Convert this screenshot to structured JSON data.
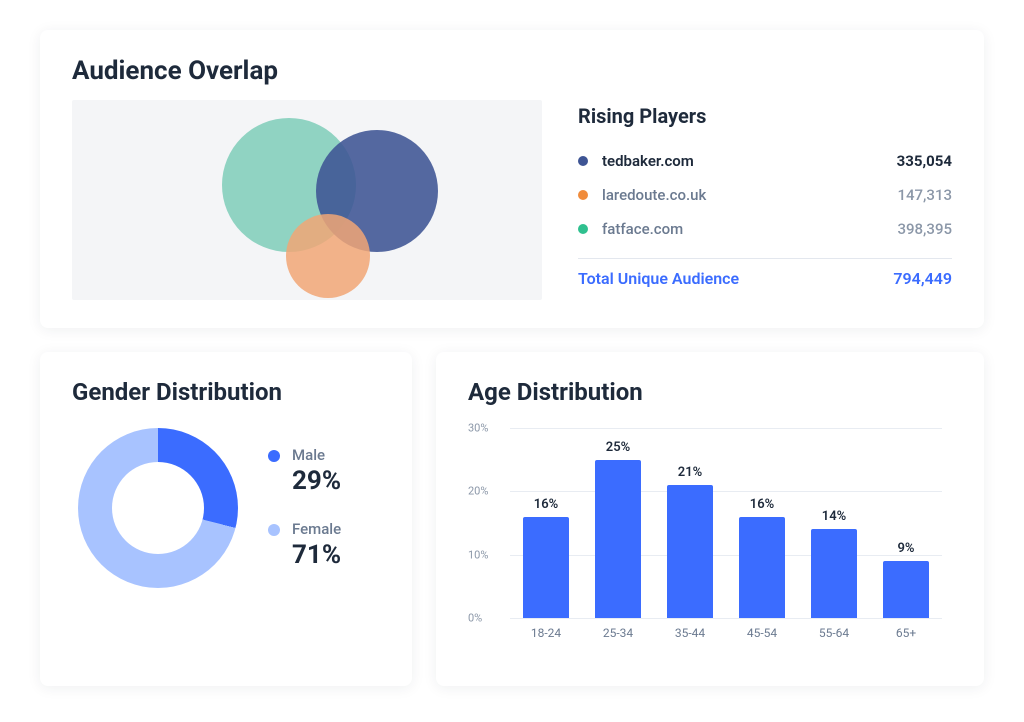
{
  "overlap": {
    "title": "Audience Overlap",
    "players_title": "Rising Players",
    "players": [
      {
        "name": "tedbaker.com",
        "value": "335,054",
        "color": "#3e5494"
      },
      {
        "name": "laredoute.co.uk",
        "value": "147,313",
        "color": "#f08c3c"
      },
      {
        "name": "fatface.com",
        "value": "398,395",
        "color": "#2fc08f"
      }
    ],
    "total_label": "Total Unique Audience",
    "total_value": "794,449"
  },
  "gender": {
    "title": "Gender Distribution",
    "items": [
      {
        "label": "Male",
        "value": "29%",
        "color": "#3b6cff"
      },
      {
        "label": "Female",
        "value": "71%",
        "color": "#a8c3ff"
      }
    ]
  },
  "age": {
    "title": "Age Distribution"
  },
  "chart_data": [
    {
      "type": "pie",
      "title": "Gender Distribution",
      "series": [
        {
          "name": "Male",
          "value": 29,
          "color": "#3b6cff"
        },
        {
          "name": "Female",
          "value": 71,
          "color": "#a8c3ff"
        }
      ]
    },
    {
      "type": "bar",
      "title": "Age Distribution",
      "xlabel": "",
      "ylabel": "",
      "ylim": [
        0,
        30
      ],
      "y_ticks": [
        "0%",
        "10%",
        "20%",
        "30%"
      ],
      "categories": [
        "18-24",
        "25-34",
        "35-44",
        "45-54",
        "55-64",
        "65+"
      ],
      "values": [
        16,
        25,
        21,
        16,
        14,
        9
      ],
      "value_labels": [
        "16%",
        "25%",
        "21%",
        "16%",
        "14%",
        "9%"
      ]
    }
  ]
}
